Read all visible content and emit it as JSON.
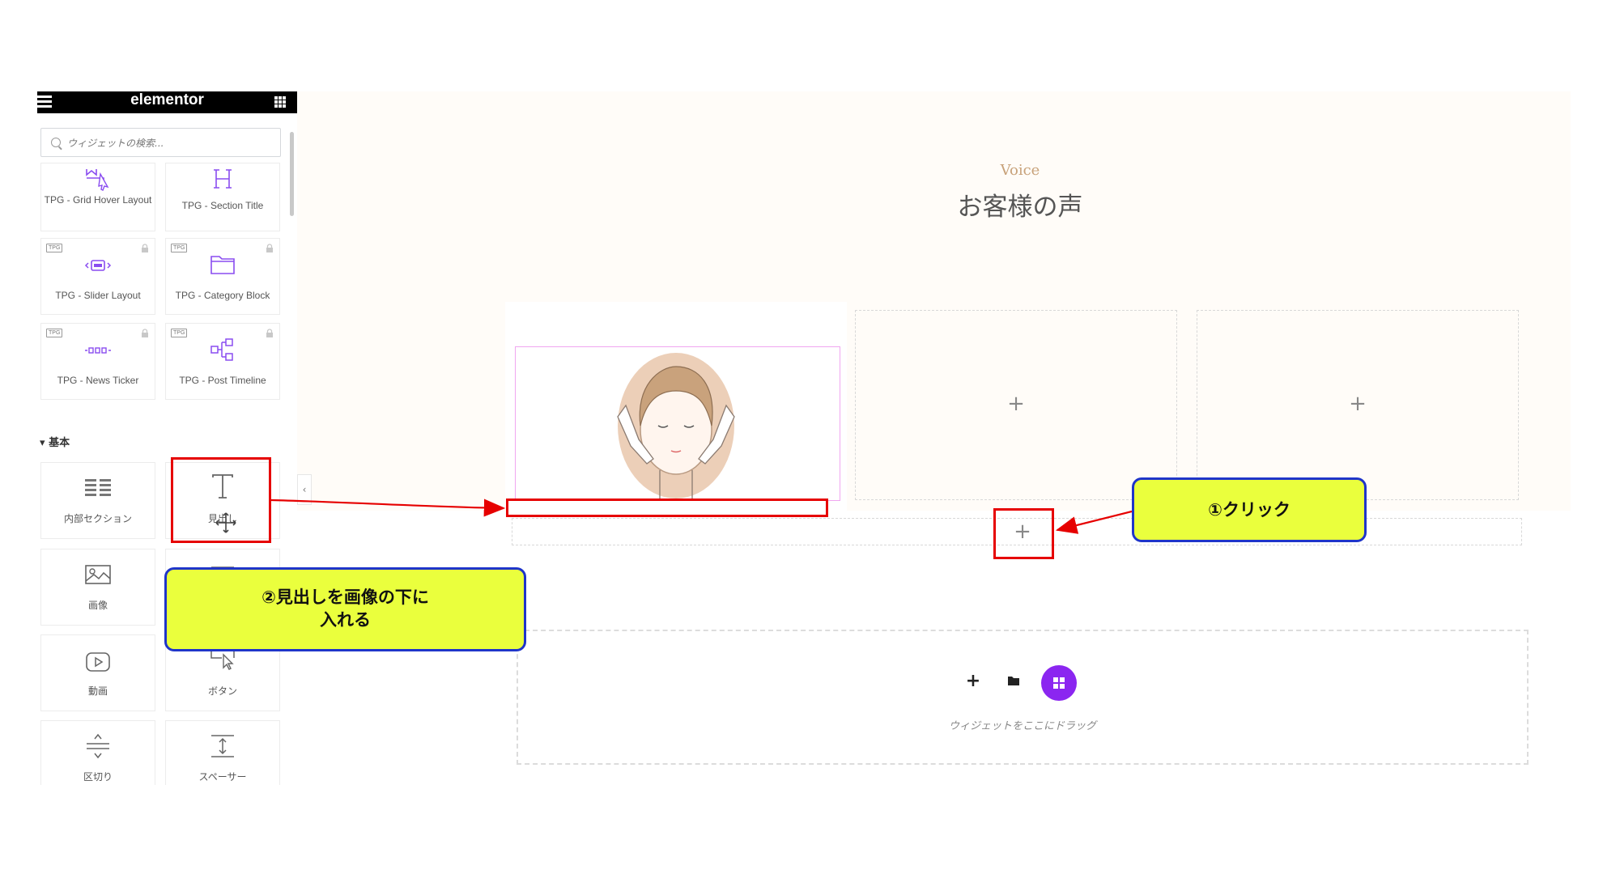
{
  "app": {
    "brand": "elementor"
  },
  "search": {
    "placeholder": "ウィジェットの検索..."
  },
  "widgets_pro": [
    {
      "label": "TPG - Grid Hover Layout",
      "icon": "grid-hover-icon",
      "badge": "",
      "locked": false
    },
    {
      "label": "TPG - Section Title",
      "icon": "section-title-icon",
      "badge": "",
      "locked": false
    },
    {
      "label": "TPG - Slider Layout",
      "icon": "slider-icon",
      "badge": "TPG",
      "locked": true
    },
    {
      "label": "TPG - Category Block",
      "icon": "folder-icon",
      "badge": "TPG",
      "locked": true
    },
    {
      "label": "TPG - News Ticker",
      "icon": "news-ticker-icon",
      "badge": "TPG",
      "locked": true
    },
    {
      "label": "TPG - Post Timeline",
      "icon": "timeline-icon",
      "badge": "TPG",
      "locked": true
    }
  ],
  "section_basic": {
    "title": "基本"
  },
  "widgets_basic": [
    {
      "label": "内部セクション",
      "icon": "inner-section-icon"
    },
    {
      "label": "見出し",
      "icon": "heading-icon"
    },
    {
      "label": "画像",
      "icon": "image-icon"
    },
    {
      "label": "",
      "icon": "text-editor-icon"
    },
    {
      "label": "動画",
      "icon": "video-icon"
    },
    {
      "label": "ボタン",
      "icon": "button-icon"
    },
    {
      "label": "区切り",
      "icon": "divider-icon"
    },
    {
      "label": "スペーサー",
      "icon": "spacer-icon"
    }
  ],
  "canvas": {
    "subtitle": "Voice",
    "heading": "お客様の声",
    "add_symbol": "+",
    "drop_zone": {
      "text": "ウィジェットをここにドラッグ"
    }
  },
  "annotations": {
    "callout1": "①クリック",
    "callout2_line1": "②見出しを画像の下に",
    "callout2_line2": "入れる"
  },
  "colors": {
    "accent": "#92003b",
    "purple": "#7c3aed",
    "callout_fill": "#eaff3d",
    "callout_border": "#1f35c9",
    "annotation_red": "#e60000"
  }
}
